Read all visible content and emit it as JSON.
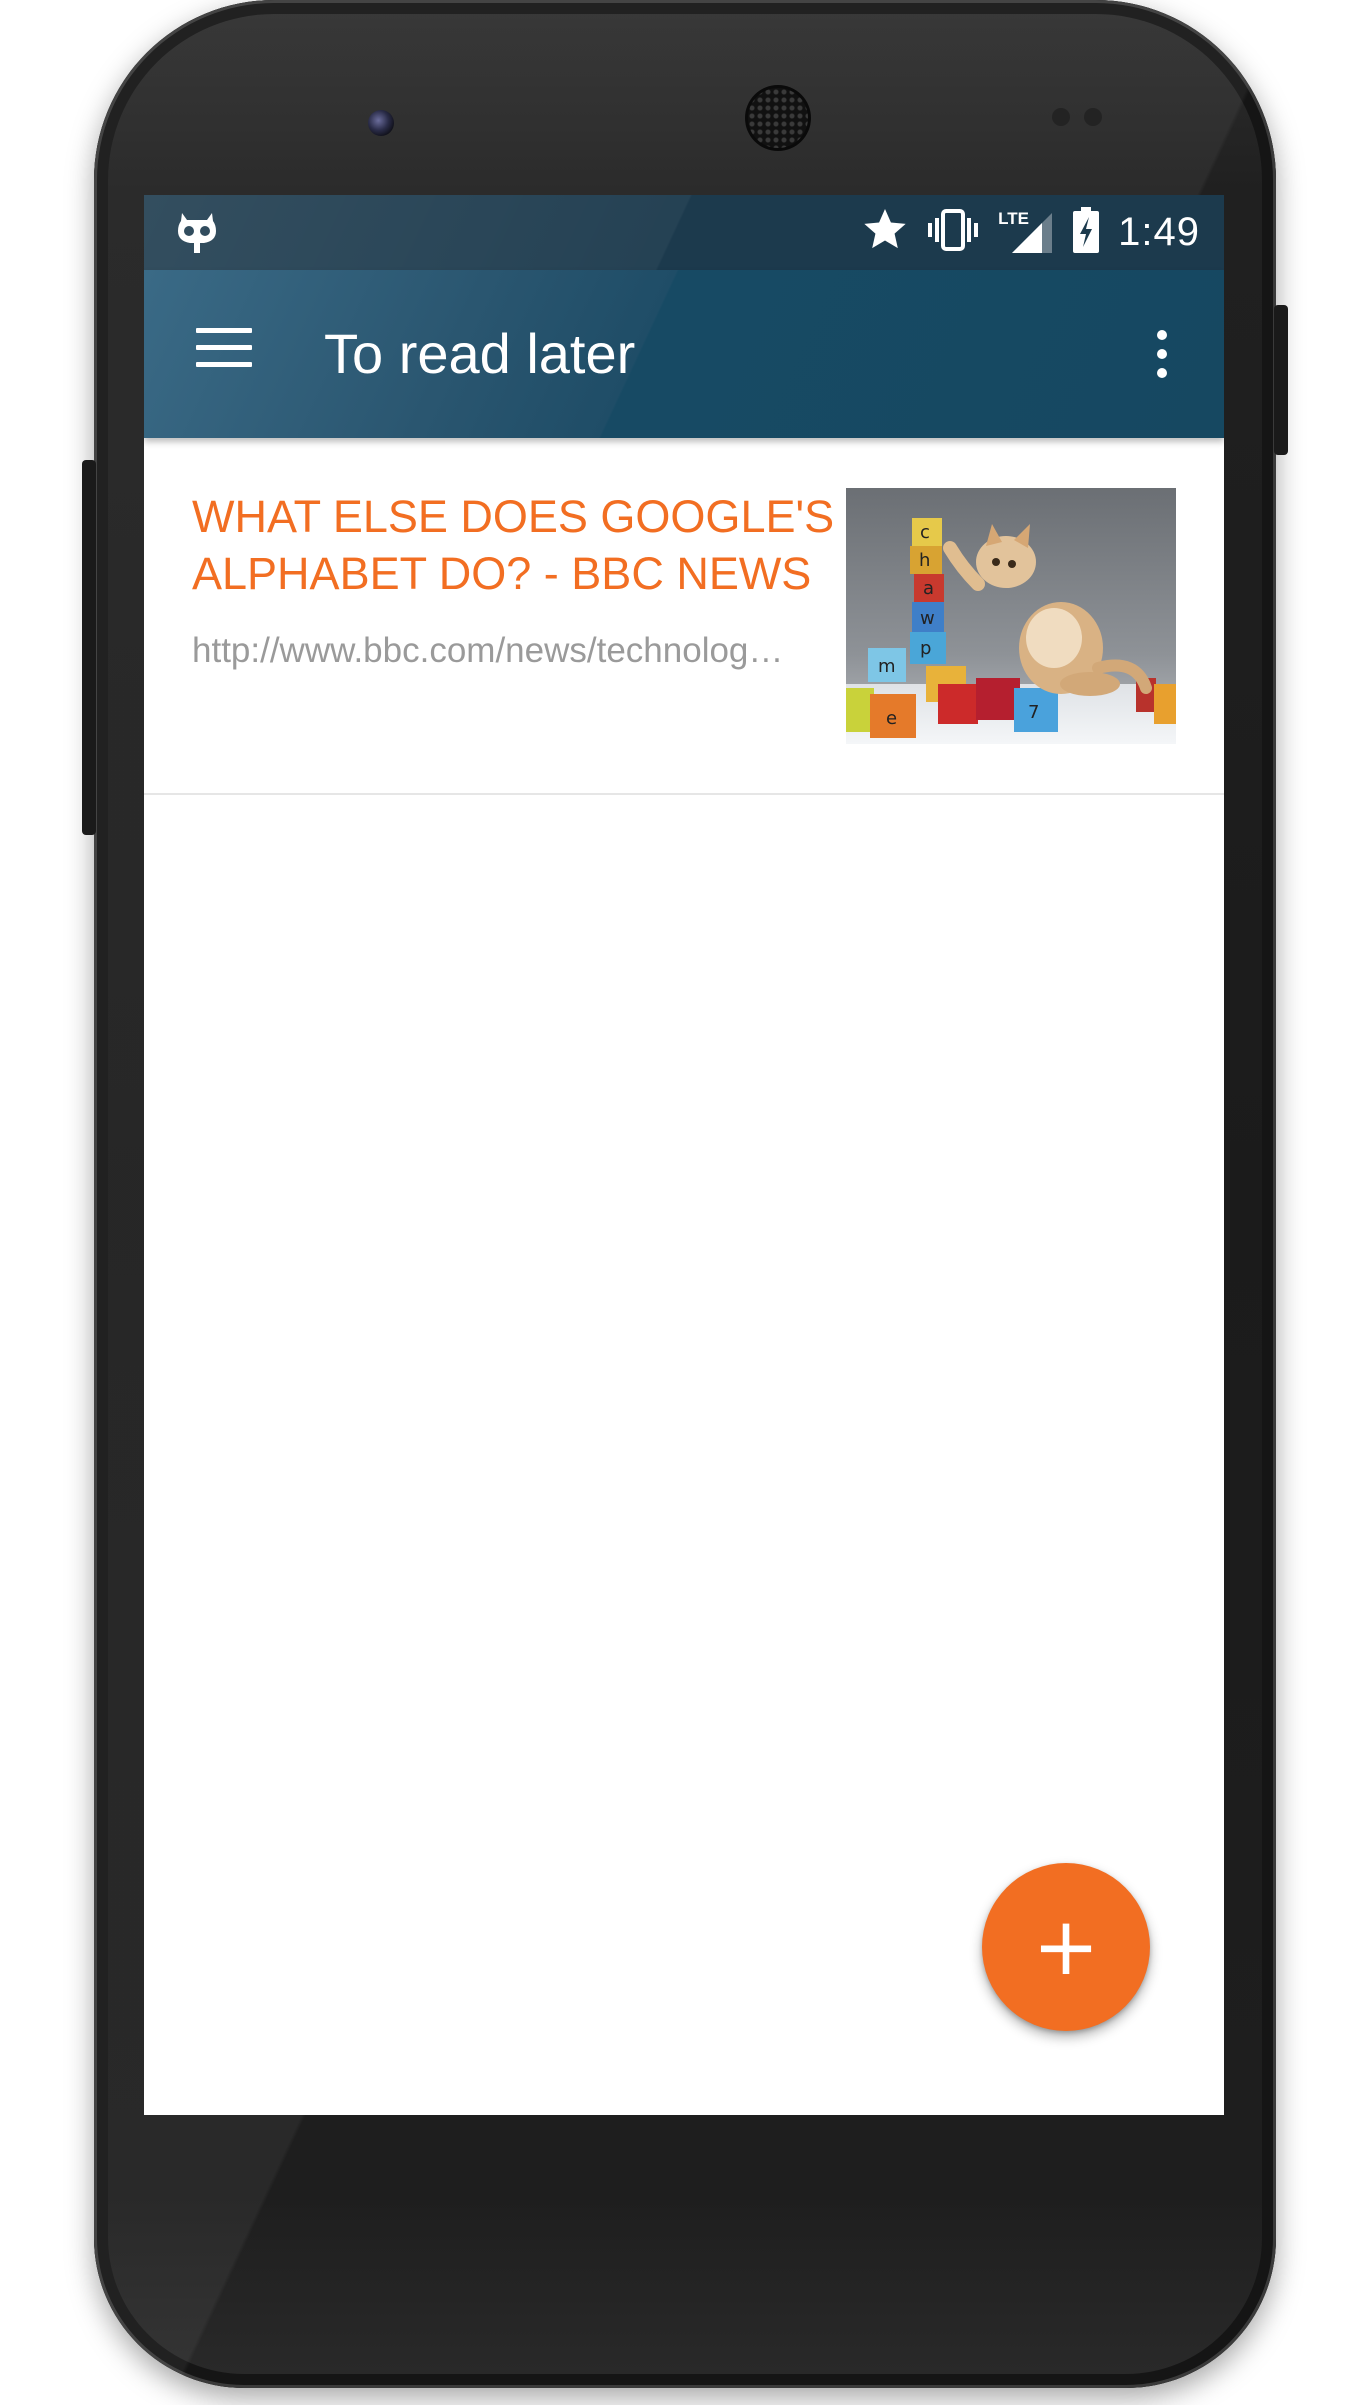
{
  "status_bar": {
    "time": "1:49",
    "network_label": "LTE",
    "icons": [
      "cyanogenmod-icon",
      "star-icon",
      "vibrate-icon",
      "lte-signal-icon",
      "battery-charging-icon"
    ]
  },
  "app_bar": {
    "title": "To read later",
    "background_color": "#1f4d67",
    "menu_icon": "hamburger-menu-icon",
    "overflow_icon": "more-vert-icon"
  },
  "articles": [
    {
      "title": "WHAT ELSE DOES GOOGLE'S ALPHABET DO? - BBC NEWS",
      "url": "http://www.bbc.com/news/technolog…",
      "thumbnail": "kitten-with-alphabet-blocks-image"
    }
  ],
  "fab": {
    "label": "+",
    "icon": "add-icon",
    "color": "#f26e22"
  },
  "accent_color": "#f26e22"
}
